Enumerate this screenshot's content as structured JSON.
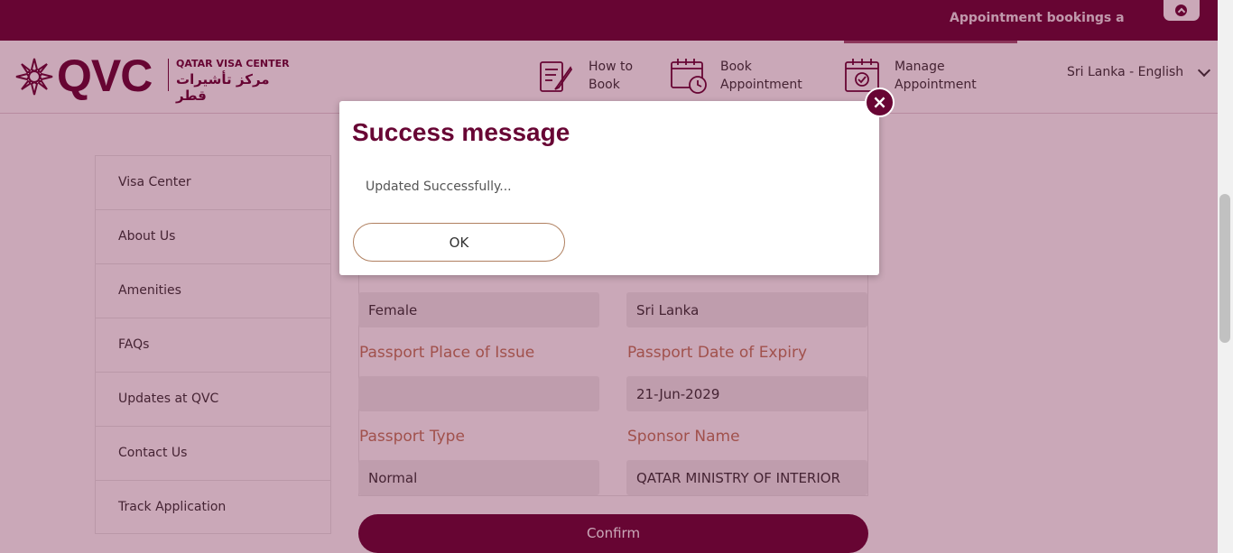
{
  "topbar": {
    "ticker": "Appointment bookings a"
  },
  "header": {
    "logo_text": "QVC",
    "logo_en": "QATAR VISA CENTER",
    "logo_ar": "مركز تأشيرات قطر",
    "nav": [
      {
        "label": "How to\nBook",
        "icon": "document-pen-icon"
      },
      {
        "label": "Book\nAppointment",
        "icon": "calendar-clock-icon"
      },
      {
        "label": "Manage\nAppointment",
        "icon": "calendar-check-icon"
      }
    ],
    "language": "Sri Lanka - English"
  },
  "sidebar": {
    "items": [
      {
        "label": "Visa Center"
      },
      {
        "label": "About Us"
      },
      {
        "label": "Amenities"
      },
      {
        "label": "FAQs"
      },
      {
        "label": "Updates at QVC"
      },
      {
        "label": "Contact Us"
      },
      {
        "label": "Track Application"
      }
    ]
  },
  "form": {
    "gender_value": "Female",
    "nationality_value": "Sri Lanka",
    "passport_place_label": "Passport Place of Issue",
    "passport_place_value": "",
    "passport_expiry_label": "Passport Date of Expiry",
    "passport_expiry_value": "21-Jun-2029",
    "passport_type_label": "Passport Type",
    "passport_type_value": "Normal",
    "sponsor_label": "Sponsor Name",
    "sponsor_value": "QATAR MINISTRY OF INTERIOR",
    "confirm_label": "Confirm"
  },
  "modal": {
    "title": "Success message",
    "message": "Updated Successfully...",
    "ok_label": "OK",
    "close_icon": "×"
  },
  "colors": {
    "brand": "#680534",
    "label_accent": "#c07a5a"
  }
}
